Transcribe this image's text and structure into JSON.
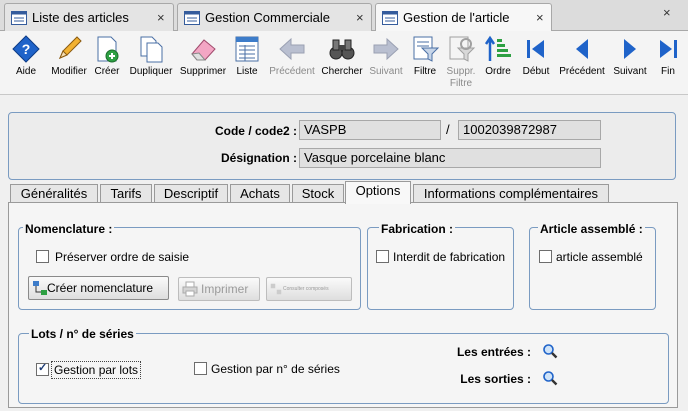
{
  "doc_tabs": [
    {
      "label": "Liste des articles",
      "close": "×"
    },
    {
      "label": "Gestion Commerciale",
      "close": "×"
    },
    {
      "label": "Gestion de l'article",
      "close": "×"
    }
  ],
  "corner_close": "×",
  "toolbar": [
    {
      "label": "Aide",
      "icon": "help-icon",
      "enabled": true
    },
    {
      "label": "Modifier",
      "icon": "pencil-icon",
      "enabled": true
    },
    {
      "label": "Créer",
      "icon": "new-document-icon",
      "enabled": true
    },
    {
      "label": "Dupliquer",
      "icon": "copy-icon",
      "enabled": true
    },
    {
      "label": "Supprimer",
      "icon": "eraser-icon",
      "enabled": true
    },
    {
      "label": "Liste",
      "icon": "list-icon",
      "enabled": true
    },
    {
      "label": "Précédent",
      "icon": "arrow-left-icon",
      "enabled": false
    },
    {
      "label": "Chercher",
      "icon": "binoculars-icon",
      "enabled": true
    },
    {
      "label": "Suivant",
      "icon": "arrow-right-icon",
      "enabled": false
    },
    {
      "label": "Filtre",
      "icon": "filter-icon",
      "enabled": true
    },
    {
      "label": "Suppr.\nFiltre",
      "icon": "remove-filter-icon",
      "enabled": false
    },
    {
      "label": "Ordre",
      "icon": "sort-order-icon",
      "enabled": true
    },
    {
      "label": "Début",
      "icon": "first-record-icon",
      "enabled": true
    },
    {
      "label": "Précédent",
      "icon": "previous-record-icon",
      "enabled": true
    },
    {
      "label": "Suivant",
      "icon": "next-record-icon",
      "enabled": true
    },
    {
      "label": "Fin",
      "icon": "last-record-icon",
      "enabled": true
    }
  ],
  "header": {
    "code_label": "Code / code2 :",
    "code_value": "VASPB",
    "separator": "/",
    "code2_value": "1002039872987",
    "designation_label": "Désignation :",
    "designation_value": "Vasque porcelaine blanc"
  },
  "page_tabs": [
    {
      "label": "Généralités",
      "active": false
    },
    {
      "label": "Tarifs",
      "active": false
    },
    {
      "label": "Descriptif",
      "active": false
    },
    {
      "label": "Achats",
      "active": false
    },
    {
      "label": "Stock",
      "active": false
    },
    {
      "label": "Options",
      "active": true
    },
    {
      "label": "Informations complémentaires",
      "active": false
    }
  ],
  "options": {
    "nomenclature": {
      "title": "Nomenclature :",
      "preserve_label": "Préserver ordre de saisie",
      "preserve_checked": false,
      "create_button": "Créer nomenclature",
      "print_button": "Imprimer",
      "consult_button": "Consulter composés"
    },
    "fabrication": {
      "title": "Fabrication :",
      "forbid_label": "Interdit de fabrication",
      "forbid_checked": false
    },
    "assembled": {
      "title": "Article assemblé :",
      "assembled_label": "article assemblé",
      "assembled_checked": false
    },
    "lots": {
      "title": "Lots / n° de séries",
      "by_lots_label": "Gestion par lots",
      "by_lots_checked": true,
      "by_serial_label": "Gestion par n° de séries",
      "by_serial_checked": false,
      "entries_label": "Les entrées :",
      "exits_label": "Les sorties :"
    }
  },
  "colors": {
    "accent_blue": "#1f63c9",
    "group_border": "#7a9bc1",
    "disabled_text": "#8a8a8a"
  }
}
